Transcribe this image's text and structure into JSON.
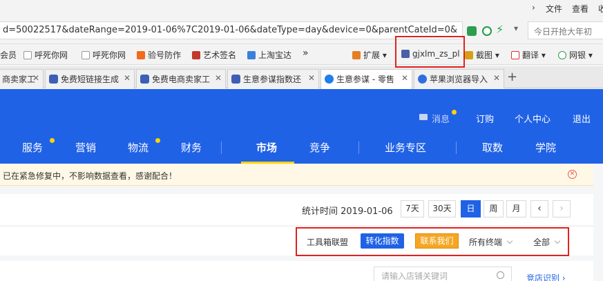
{
  "window_menu": {
    "file": "文件",
    "view": "查看",
    "collect": "收"
  },
  "address_bar": {
    "url": "d=50022517&dateRange=2019-01-06%7C2019-01-06&dateType=day&device=0&parentCateId=0&",
    "search_placeholder": "今日开抢大年初"
  },
  "bookmarks": [
    "会员",
    "呼死你网",
    "呼死你网",
    "验号防作",
    "艺术签名",
    "上淘宝达"
  ],
  "bookmarks_more": "»",
  "extensions": {
    "expand": "扩展",
    "plugin": "gjxlm_zs_pl",
    "screenshot": "截图",
    "translate": "翻译",
    "netbank": "网银"
  },
  "tabs": [
    {
      "label": "商卖家工"
    },
    {
      "label": "免费短链接生成"
    },
    {
      "label": "免费电商卖家工"
    },
    {
      "label": "生意参谋指数还"
    },
    {
      "label": "生意参谋 - 零售"
    },
    {
      "label": "苹果浏览器导入"
    }
  ],
  "tab_new": "+",
  "header": {
    "links": {
      "message": "消息",
      "order": "订购",
      "personal": "个人中心",
      "logout": "退出"
    },
    "nav": [
      "服务",
      "营销",
      "物流",
      "财务",
      "市场",
      "竞争",
      "业务专区",
      "取数",
      "学院"
    ]
  },
  "notice": {
    "text": "已在紧急修复中，不影响数据查看，感谢配合！"
  },
  "filters": {
    "stat_label": "统计时间 2019-01-06",
    "ranges": [
      "7天",
      "30天",
      "日",
      "周",
      "月"
    ],
    "prev": "‹",
    "next": "›"
  },
  "toolbar": {
    "tool_alliance": "工具箱联盟",
    "conversion_index": "转化指数",
    "contact_us": "联系我们",
    "terminal": "所有终端",
    "all": "全部"
  },
  "shop": {
    "search_placeholder": "请输入店铺关键词",
    "identify": "竞店识别"
  },
  "colors": {
    "brand_blue": "#2062e6",
    "accent_yellow": "#ffd400",
    "contact_orange": "#f5a623",
    "highlight_red": "#e02020"
  }
}
